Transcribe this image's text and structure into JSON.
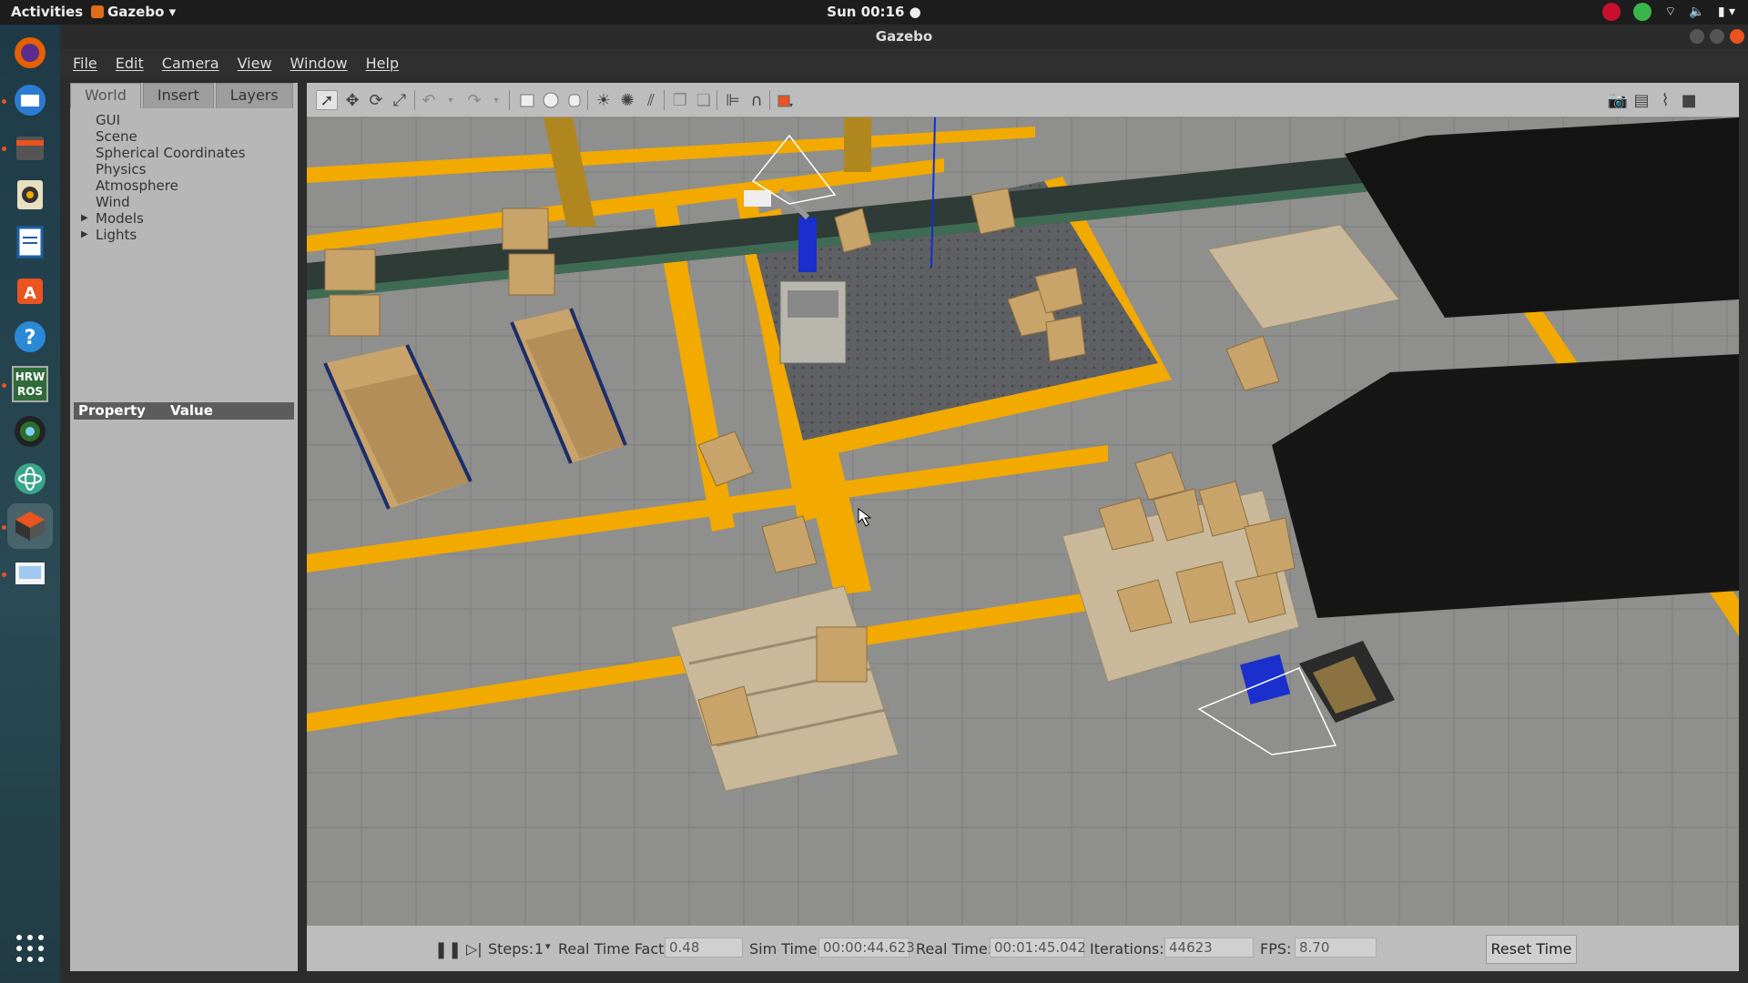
{
  "topbar": {
    "activities": "Activities",
    "app_name": "Gazebo",
    "clock": "Sun 00:16"
  },
  "window": {
    "title": "Gazebo"
  },
  "menu": [
    "File",
    "Edit",
    "Camera",
    "View",
    "Window",
    "Help"
  ],
  "dock": {
    "items": [
      "firefox-icon",
      "thunderbird-icon",
      "files-icon",
      "rhythmbox-icon",
      "writer-icon",
      "software-icon",
      "help-icon",
      "hrwros-icon",
      "camera-icon",
      "atom-icon",
      "gazebo-icon",
      "image-viewer-icon",
      "app-grid-icon"
    ],
    "hrwros_label_1": "HRW",
    "hrwros_label_2": "ROS"
  },
  "left_panel": {
    "tabs": [
      "World",
      "Insert",
      "Layers"
    ],
    "active_tab": "World",
    "tree": [
      "GUI",
      "Scene",
      "Spherical Coordinates",
      "Physics",
      "Atmosphere",
      "Wind",
      "Models",
      "Lights"
    ],
    "property_header": "Property",
    "value_header": "Value"
  },
  "toolbar": {
    "tools": [
      "select-mode",
      "translate-mode",
      "rotate-mode",
      "scale-mode",
      "undo",
      "redo",
      "box",
      "sphere",
      "cylinder",
      "point-light",
      "spot-light",
      "directional-light",
      "copy",
      "paste",
      "align",
      "snap",
      "view-angle"
    ],
    "right_tools": [
      "screenshot",
      "log",
      "plot",
      "record-video"
    ]
  },
  "status": {
    "steps_label": "Steps:",
    "steps_value": "1",
    "rtf_label": "Real Time Factor:",
    "rtf_value": "0.48",
    "sim_time_label": "Sim Time:",
    "sim_time_value": "00:00:44.623",
    "real_time_label": "Real Time:",
    "real_time_value": "00:01:45.042",
    "iterations_label": "Iterations:",
    "iterations_value": "44623",
    "fps_label": "FPS:",
    "fps_value": "8.70",
    "reset_label": "Reset Time"
  },
  "colors": {
    "floor": "#8e8e8c",
    "stripe": "#f2a900",
    "box": "#c8a36a",
    "pallet": "#c9b99a",
    "conveyor": "#2f3b36",
    "robot_blue": "#1a2fcc"
  }
}
